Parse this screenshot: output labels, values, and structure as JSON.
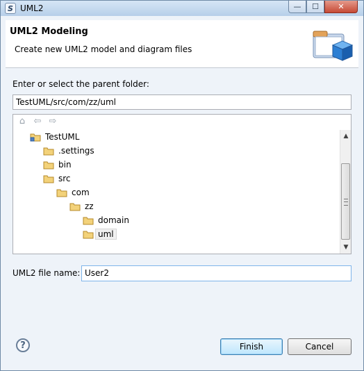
{
  "window": {
    "title": "UML2"
  },
  "banner": {
    "title": "UML2 Modeling",
    "subtitle": "Create new UML2 model and diagram files"
  },
  "folder_section": {
    "label": "Enter or select the parent folder:",
    "path_value": "TestUML/src/com/zz/uml"
  },
  "tree": {
    "nav": {
      "home": "⌂",
      "back": "⇦",
      "forward": "⇨"
    },
    "items": [
      {
        "label": "TestUML",
        "level": 0,
        "icon": "project-folder-icon"
      },
      {
        "label": ".settings",
        "level": 1,
        "icon": "folder-icon"
      },
      {
        "label": "bin",
        "level": 1,
        "icon": "folder-icon"
      },
      {
        "label": "src",
        "level": 1,
        "icon": "folder-icon"
      },
      {
        "label": "com",
        "level": 2,
        "icon": "folder-icon"
      },
      {
        "label": "zz",
        "level": 3,
        "icon": "folder-icon"
      },
      {
        "label": "domain",
        "level": 4,
        "icon": "folder-icon"
      },
      {
        "label": "uml",
        "level": 4,
        "icon": "folder-icon",
        "selected": true
      }
    ]
  },
  "file_section": {
    "label": "UML2 file name:",
    "value": "User2"
  },
  "buttons": {
    "help": "?",
    "finish": "Finish",
    "cancel": "Cancel"
  },
  "window_controls": {
    "minimize": "—",
    "maximize": "☐",
    "close": "✕"
  }
}
